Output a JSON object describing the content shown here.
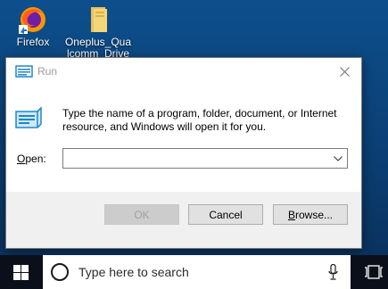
{
  "desktop": {
    "icons": [
      {
        "name": "firefox",
        "label": "Firefox"
      },
      {
        "name": "folder",
        "label": "Oneplus_Qua\nlcomm_Drive"
      }
    ]
  },
  "run_dialog": {
    "title": "Run",
    "description": "Type the name of a program, folder, document, or Internet resource, and Windows will open it for you.",
    "open_label_accel": "O",
    "open_label_rest": "pen:",
    "open_value": "",
    "buttons": {
      "ok": "OK",
      "cancel": "Cancel",
      "browse_accel": "B",
      "browse_rest": "rowse..."
    },
    "ok_enabled": false
  },
  "taskbar": {
    "search_placeholder": "Type here to search"
  },
  "colors": {
    "taskbar": "#0b0f1a",
    "dialog_footer": "#f0f0f0",
    "button_face": "#e1e1e1",
    "accent_icon": "#1e88c8"
  }
}
